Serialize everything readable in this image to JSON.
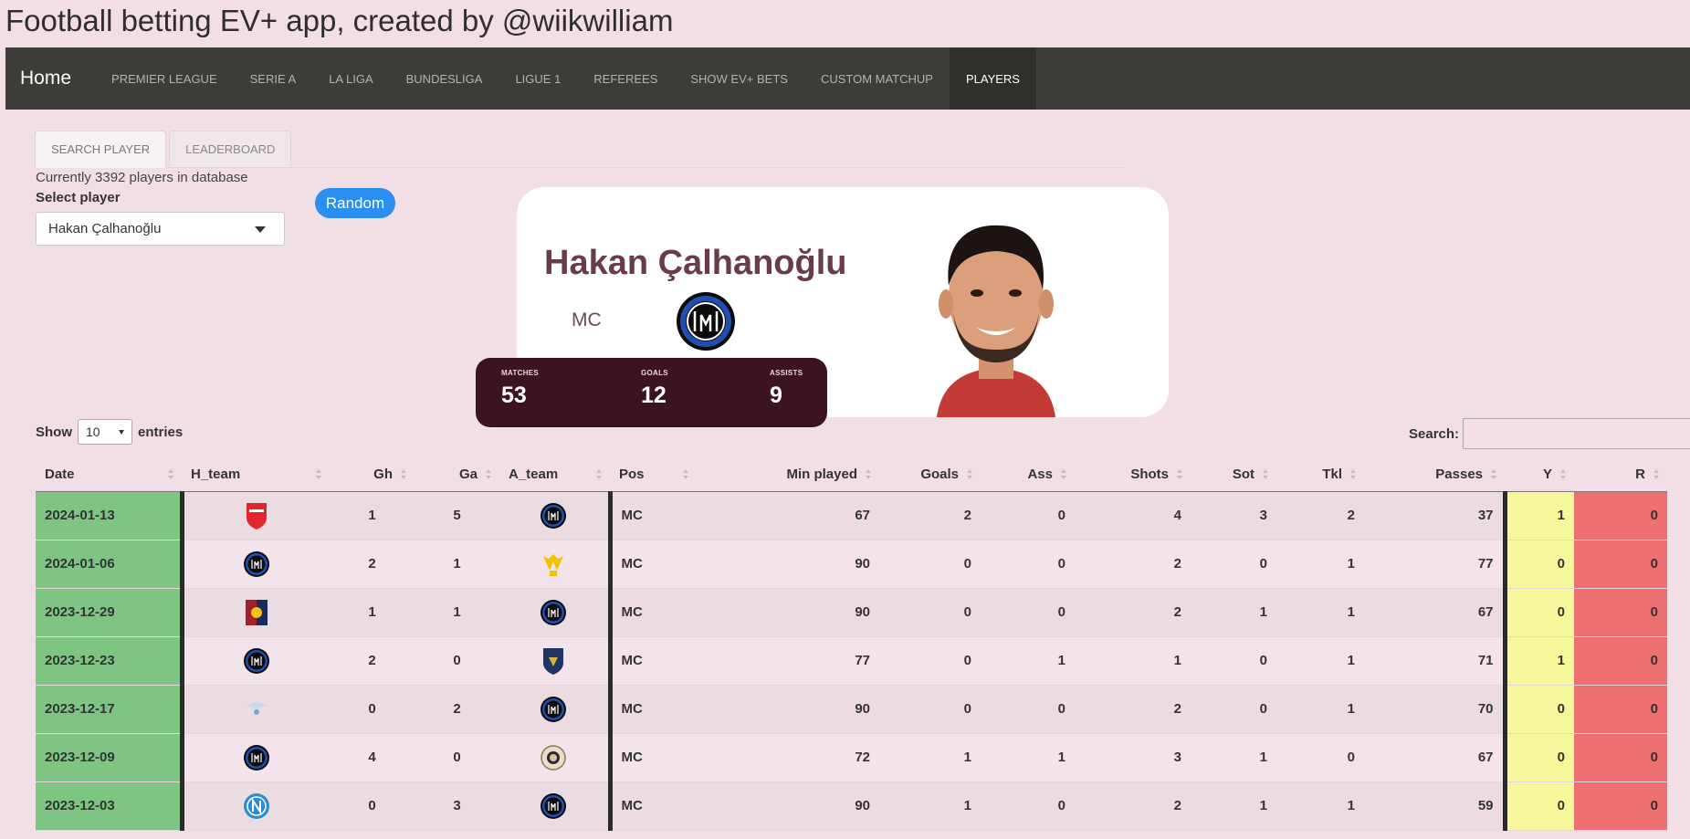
{
  "app": {
    "title": "Football betting EV+ app, created by @wiikwilliam"
  },
  "nav": {
    "brand": "Home",
    "items": [
      {
        "label": "PREMIER LEAGUE"
      },
      {
        "label": "SERIE A"
      },
      {
        "label": "LA LIGA"
      },
      {
        "label": "BUNDESLIGA"
      },
      {
        "label": "LIGUE 1"
      },
      {
        "label": "REFEREES"
      },
      {
        "label": "SHOW EV+ BETS"
      },
      {
        "label": "CUSTOM MATCHUP"
      },
      {
        "label": "PLAYERS",
        "active": true
      }
    ]
  },
  "tabs": [
    {
      "label": "SEARCH PLAYER",
      "active": true
    },
    {
      "label": "LEADERBOARD"
    }
  ],
  "search_panel": {
    "db_count": "Currently 3392 players in database",
    "select_label": "Select player",
    "selected_player": "Hakan Çalhanoğlu",
    "random_label": "Random"
  },
  "player_card": {
    "name": "Hakan Çalhanoğlu",
    "position": "MC",
    "club_icon": "inter-crest-icon",
    "stats": [
      {
        "label": "MATCHES",
        "value": "53"
      },
      {
        "label": "GOALS",
        "value": "12"
      },
      {
        "label": "ASSISTS",
        "value": "9"
      }
    ]
  },
  "table_controls": {
    "show_label": "Show",
    "entries_value": "10",
    "entries_label": "entries",
    "search_label": "Search:"
  },
  "table": {
    "columns": [
      "Date",
      "H_team",
      "Gh",
      "Ga",
      "A_team",
      "Pos",
      "Min played",
      "Goals",
      "Ass",
      "Shots",
      "Sot",
      "Tkl",
      "Passes",
      "Y",
      "R"
    ],
    "rows": [
      {
        "date": "2024-01-13",
        "h_team": "monza",
        "gh": "1",
        "ga": "5",
        "a_team": "inter",
        "pos": "MC",
        "min": "67",
        "goals": "2",
        "ass": "0",
        "shots": "4",
        "sot": "3",
        "tkl": "2",
        "passes": "37",
        "y": "1",
        "r": "0"
      },
      {
        "date": "2024-01-06",
        "h_team": "inter",
        "gh": "2",
        "ga": "1",
        "a_team": "verona",
        "pos": "MC",
        "min": "90",
        "goals": "0",
        "ass": "0",
        "shots": "2",
        "sot": "0",
        "tkl": "1",
        "passes": "77",
        "y": "0",
        "r": "0"
      },
      {
        "date": "2023-12-29",
        "h_team": "genoa",
        "gh": "1",
        "ga": "1",
        "a_team": "inter",
        "pos": "MC",
        "min": "90",
        "goals": "0",
        "ass": "0",
        "shots": "2",
        "sot": "1",
        "tkl": "1",
        "passes": "67",
        "y": "0",
        "r": "0"
      },
      {
        "date": "2023-12-23",
        "h_team": "inter",
        "gh": "2",
        "ga": "0",
        "a_team": "lecce",
        "pos": "MC",
        "min": "77",
        "goals": "0",
        "ass": "1",
        "shots": "1",
        "sot": "0",
        "tkl": "1",
        "passes": "71",
        "y": "1",
        "r": "0"
      },
      {
        "date": "2023-12-17",
        "h_team": "lazio",
        "gh": "0",
        "ga": "2",
        "a_team": "inter",
        "pos": "MC",
        "min": "90",
        "goals": "0",
        "ass": "0",
        "shots": "2",
        "sot": "0",
        "tkl": "1",
        "passes": "70",
        "y": "0",
        "r": "0"
      },
      {
        "date": "2023-12-09",
        "h_team": "inter",
        "gh": "4",
        "ga": "0",
        "a_team": "udinese",
        "pos": "MC",
        "min": "72",
        "goals": "1",
        "ass": "1",
        "shots": "3",
        "sot": "1",
        "tkl": "0",
        "passes": "67",
        "y": "0",
        "r": "0"
      },
      {
        "date": "2023-12-03",
        "h_team": "napoli",
        "gh": "0",
        "ga": "3",
        "a_team": "inter",
        "pos": "MC",
        "min": "90",
        "goals": "1",
        "ass": "0",
        "shots": "2",
        "sot": "1",
        "tkl": "1",
        "passes": "59",
        "y": "0",
        "r": "0"
      }
    ]
  },
  "colors": {
    "date_cell": "#7ec584",
    "yellow_cell": "#f6f69a",
    "red_cell": "#ef7070",
    "name_color": "#6a3b4d",
    "stats_bg": "#3b141f",
    "random_btn": "#2a8ff0"
  }
}
